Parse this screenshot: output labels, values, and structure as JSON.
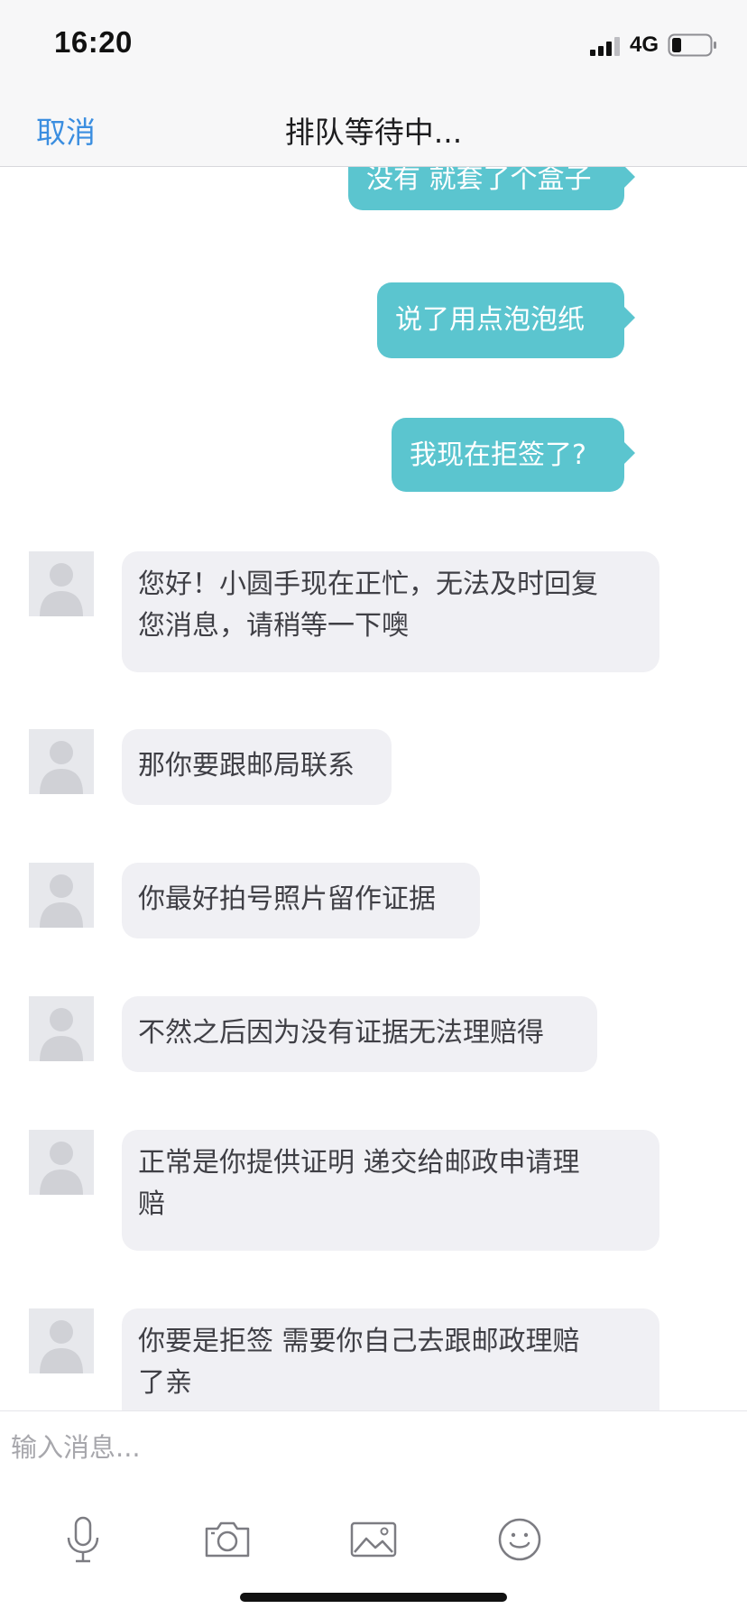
{
  "status_bar": {
    "time": "16:20",
    "network": "4G",
    "icons": [
      "signal-icon",
      "battery-icon"
    ]
  },
  "nav": {
    "cancel_label": "取消",
    "title": "排队等待中..."
  },
  "messages": {
    "outgoing": [
      "没有 就套了个盒子",
      "说了用点泡泡纸",
      "我现在拒签了?"
    ],
    "incoming": [
      {
        "line1": "您好！小圆手现在正忙，无法及时回复",
        "line2": "您消息，请稍等一下噢"
      },
      {
        "line1": "那你要跟邮局联系"
      },
      {
        "line1": "你最好拍号照片留作证据"
      },
      {
        "line1": "不然之后因为没有证据无法理赔得"
      },
      {
        "line1": "正常是你提供证明 递交给邮政申请理",
        "line2": "赔"
      },
      {
        "line1": "你要是拒签 需要你自己去跟邮政理赔",
        "line2": "了亲"
      }
    ]
  },
  "input": {
    "placeholder": "输入消息..."
  },
  "toolbar": {
    "icons": [
      "microphone-icon",
      "camera-icon",
      "image-icon",
      "emoji-icon"
    ]
  },
  "colors": {
    "outgoing_bubble": "#5bc5cf",
    "incoming_bubble": "#f0f0f4",
    "accent": "#3b8ee0"
  }
}
